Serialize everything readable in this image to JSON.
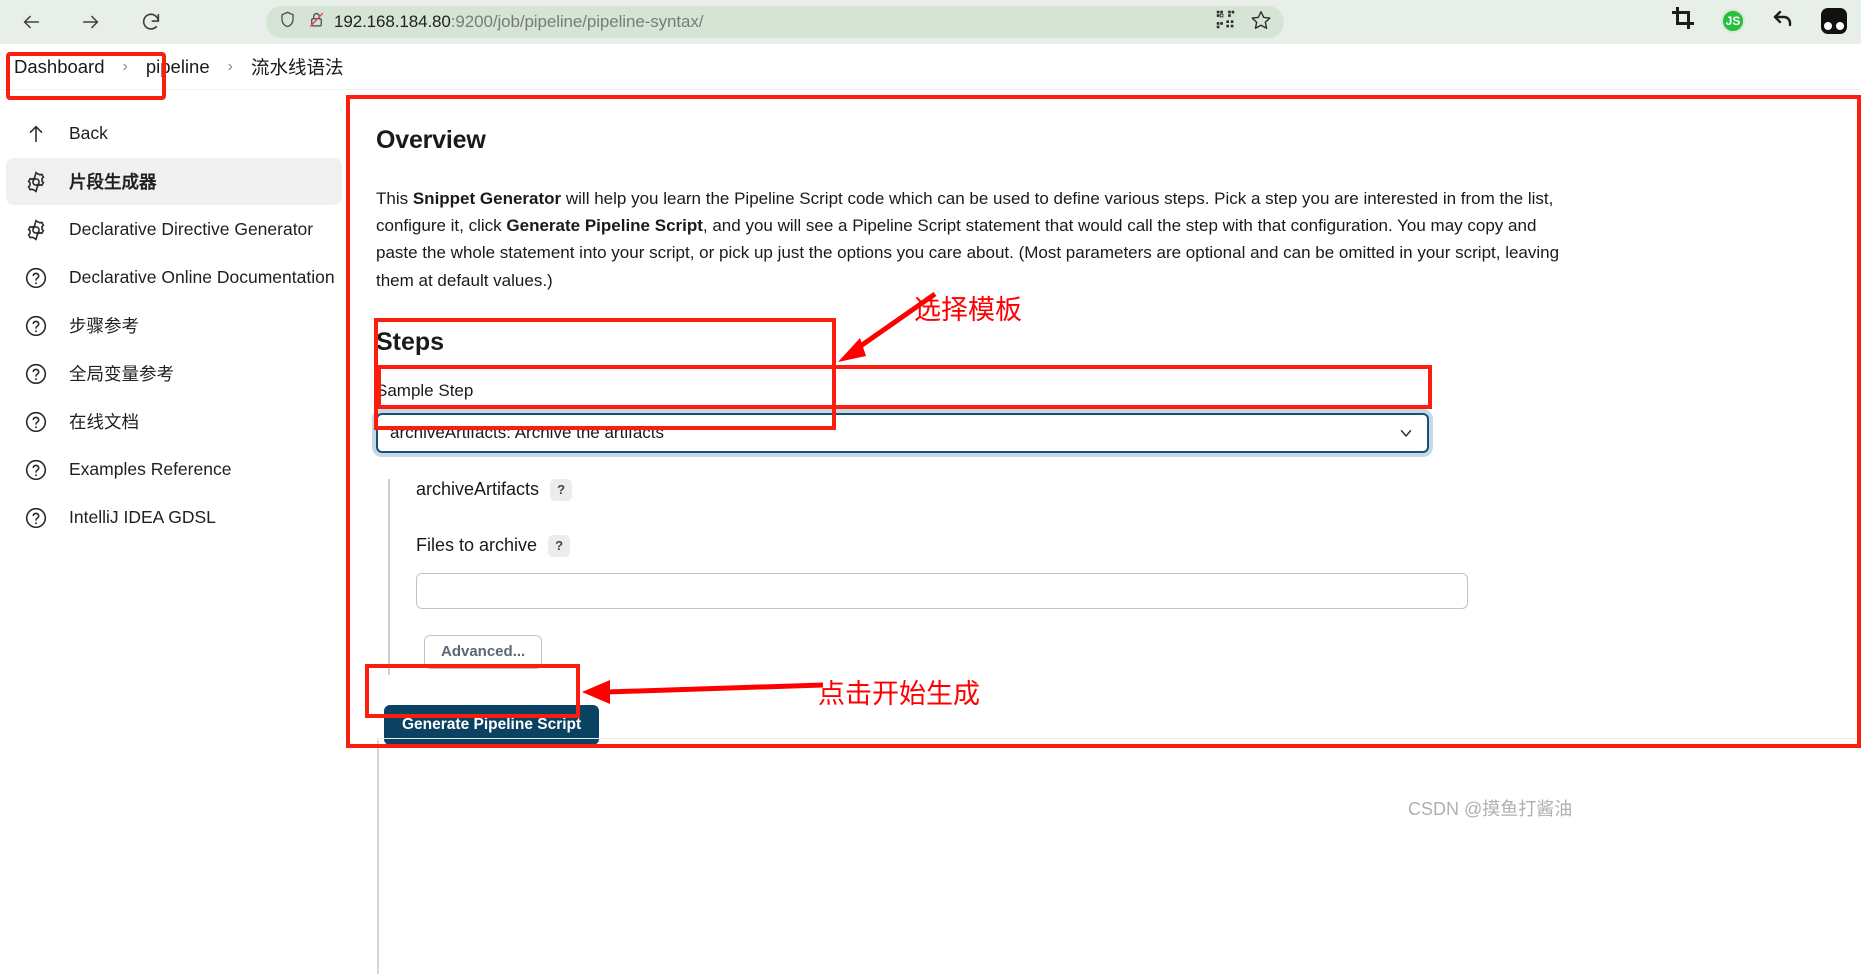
{
  "browser": {
    "back_icon": "back-arrow-icon",
    "forward_icon": "forward-arrow-icon",
    "reload_icon": "reload-icon",
    "shield_icon": "shield-icon",
    "insecure_icon": "insecure-lock-icon",
    "url_host": "192.168.184.80",
    "url_rest": ":9200/job/pipeline/pipeline-syntax/",
    "qr_icon": "qr-code-icon",
    "bookmark_icon": "star-bookmark-icon",
    "crop_icon": "crop-capture-icon",
    "js_badge": "JS",
    "undo_icon": "undo-arrow-icon",
    "profile_icon": "profile-avatar-icon"
  },
  "breadcrumb": {
    "items": [
      {
        "label": "Dashboard"
      },
      {
        "label": "pipeline"
      },
      {
        "label": "流水线语法"
      }
    ],
    "separator": "›"
  },
  "sidebar": {
    "items": [
      {
        "label": "Back",
        "icon": "up-arrow-icon",
        "active": false
      },
      {
        "label": "片段生成器",
        "icon": "gear-icon",
        "active": true
      },
      {
        "label": "Declarative Directive Generator",
        "icon": "gear-icon",
        "active": false
      },
      {
        "label": "Declarative Online Documentation",
        "icon": "help-circle-icon",
        "active": false
      },
      {
        "label": "步骤参考",
        "icon": "help-circle-icon",
        "active": false
      },
      {
        "label": "全局变量参考",
        "icon": "help-circle-icon",
        "active": false
      },
      {
        "label": "在线文档",
        "icon": "help-circle-icon",
        "active": false
      },
      {
        "label": "Examples Reference",
        "icon": "help-circle-icon",
        "active": false
      },
      {
        "label": "IntelliJ IDEA GDSL",
        "icon": "help-circle-icon",
        "active": false
      }
    ]
  },
  "main": {
    "overview_title": "Overview",
    "overview_p1": "This ",
    "overview_b1": "Snippet Generator",
    "overview_p2": " will help you learn the Pipeline Script code which can be used to define various steps. Pick a step you are interested in from the list, configure it, click ",
    "overview_b2": "Generate Pipeline Script",
    "overview_p3": ", and you will see a Pipeline Script statement that would call the step with that configuration. You may copy and paste the whole statement into your script, or pick up just the options you care about. (Most parameters are optional and can be omitted in your script, leaving them at default values.)",
    "steps_title": "Steps",
    "sample_step_label": "Sample Step",
    "sample_step_value": "archiveArtifacts: Archive the artifacts",
    "sample_step_options": [
      "archiveArtifacts: Archive the artifacts"
    ],
    "chevron_icon": "chevron-down-icon",
    "archive_section_label": "archiveArtifacts",
    "archive_help": "?",
    "files_label": "Files to archive",
    "files_help": "?",
    "files_value": "",
    "files_placeholder": "",
    "advanced_label": "Advanced...",
    "generate_label": "Generate Pipeline Script"
  },
  "annotations": {
    "template_note": "选择模板",
    "generate_note": "点击开始生成",
    "watermark": "CSDN @摸鱼打酱油",
    "highlight_color": "#fb1d0e"
  }
}
